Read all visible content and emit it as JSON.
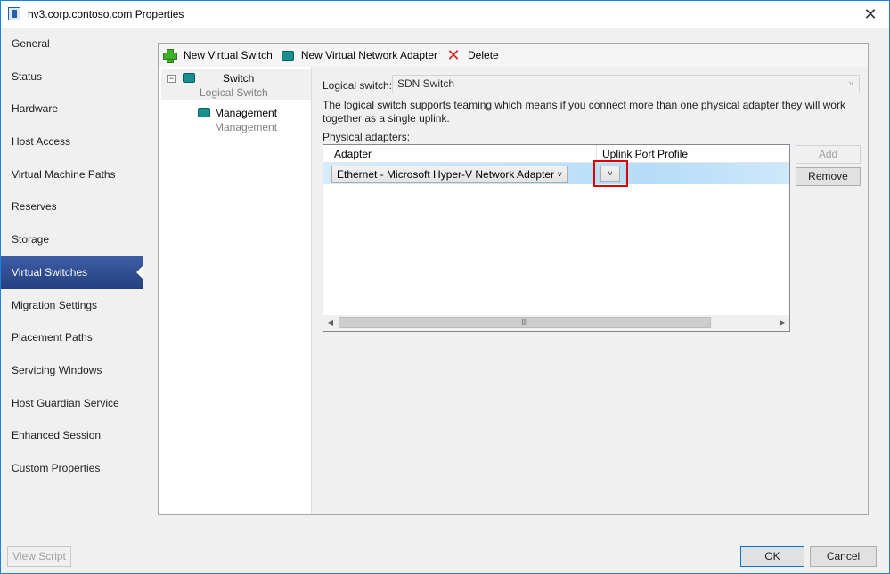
{
  "window": {
    "title": "hv3.corp.contoso.com Properties",
    "close_glyph": "✕"
  },
  "sidebar": {
    "items": [
      {
        "label": "General"
      },
      {
        "label": "Status"
      },
      {
        "label": "Hardware"
      },
      {
        "label": "Host Access"
      },
      {
        "label": "Virtual Machine Paths"
      },
      {
        "label": "Reserves"
      },
      {
        "label": "Storage"
      },
      {
        "label": "Virtual Switches",
        "selected": true
      },
      {
        "label": "Migration Settings"
      },
      {
        "label": "Placement Paths"
      },
      {
        "label": "Servicing Windows"
      },
      {
        "label": "Host Guardian Service"
      },
      {
        "label": "Enhanced Session"
      },
      {
        "label": "Custom Properties"
      }
    ]
  },
  "toolbar": {
    "new_switch": "New Virtual Switch",
    "new_adapter": "New Virtual Network Adapter",
    "delete": "Delete",
    "delete_glyph": "✕"
  },
  "tree": {
    "switch_name": "Switch",
    "switch_type": "Logical Switch",
    "adapter_name": "Management",
    "adapter_type": "Management",
    "expander_glyph": "−"
  },
  "detail": {
    "logical_switch_label": "Logical switch:",
    "logical_switch_value": "SDN Switch",
    "description": "The logical switch supports teaming which means if you connect more than one physical adapter they will work together as a single uplink.",
    "physical_adapters_label": "Physical adapters:",
    "grid": {
      "columns": [
        "Adapter",
        "Uplink Port Profile"
      ],
      "rows": [
        {
          "adapter": "Ethernet - Microsoft Hyper-V Network Adapter",
          "uplink_port_profile": ""
        }
      ],
      "scroll_grip": "III"
    },
    "add_label": "Add",
    "remove_label": "Remove",
    "dropdown_glyph": "˅"
  },
  "footer": {
    "view_script": "View Script",
    "ok": "OK",
    "cancel": "Cancel"
  },
  "colors": {
    "selected_nav": "#2d4a8c",
    "highlight_box": "#e00000",
    "row_selected": "#b6dcf7"
  }
}
